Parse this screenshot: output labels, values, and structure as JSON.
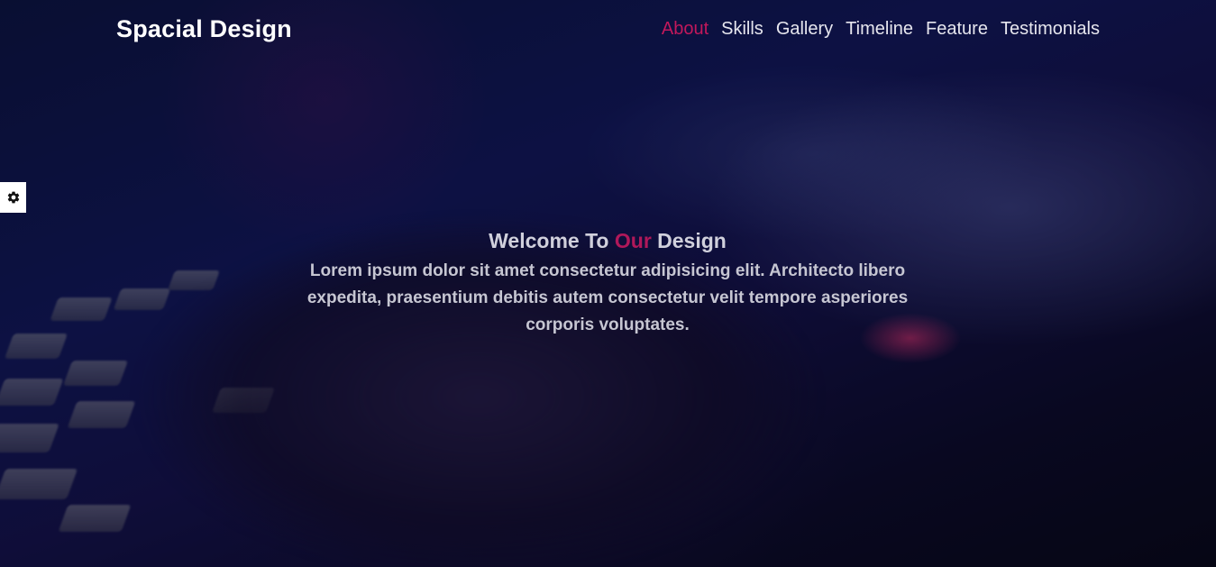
{
  "brand": {
    "title": "Spacial Design"
  },
  "nav": {
    "items": [
      {
        "label": "About",
        "active": true
      },
      {
        "label": "Skills",
        "active": false
      },
      {
        "label": "Gallery",
        "active": false
      },
      {
        "label": "Timeline",
        "active": false
      },
      {
        "label": "Feature",
        "active": false
      },
      {
        "label": "Testimonials",
        "active": false
      }
    ]
  },
  "settings_toggle": {
    "icon": "gear-icon"
  },
  "hero": {
    "title_part1": "Welcome To ",
    "title_accent": "Our",
    "title_part2": " Design",
    "description": "Lorem ipsum dolor sit amet consectetur adipisicing elit. Architecto libero expedita, praesentium debitis autem consectetur velit tempore asperiores corporis voluptates."
  },
  "colors": {
    "accent": "#c2185b",
    "nav_text": "#e6e6ee",
    "brand_text": "#ffffff"
  }
}
